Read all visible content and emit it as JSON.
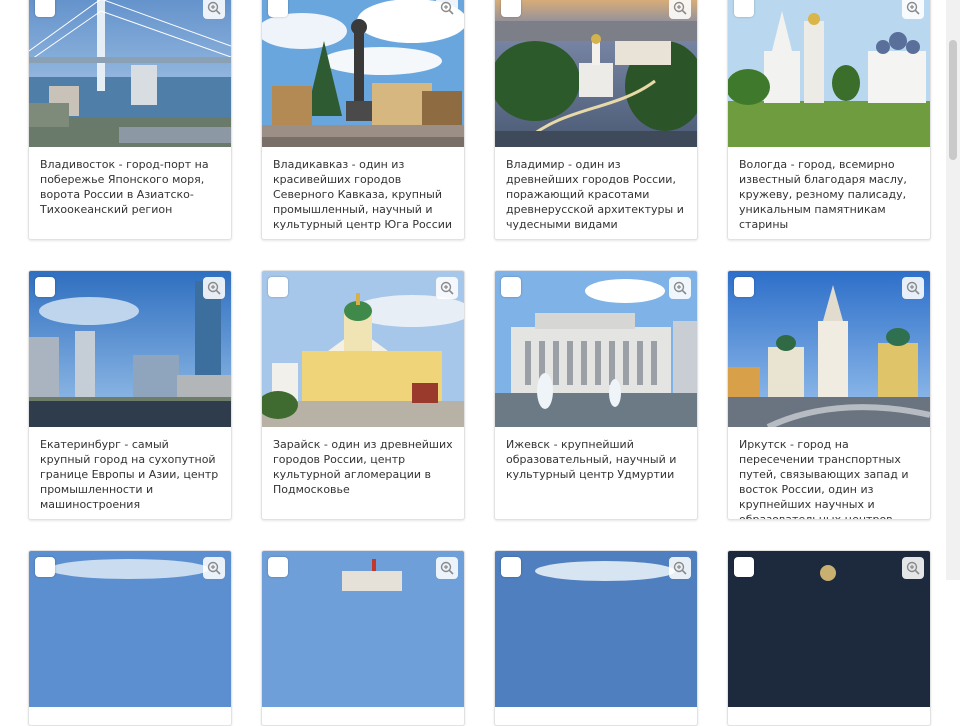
{
  "cards": [
    {
      "caption": "Владивосток - город-порт на побережье Японского моря, ворота России в Азиатско-Тихоокеанский регион"
    },
    {
      "caption": "Владикавказ - один из красивейших городов Северного Кавказа, крупный промышленный, научный и культурный центр Юга России"
    },
    {
      "caption": "Владимир - один из древнейших городов России, поражающий красотами древнерусской архитектуры и чудесными видами"
    },
    {
      "caption": "Вологда - город, всемирно известный благодаря маслу, кружеву, резному палисаду, уникальным памятникам старины"
    },
    {
      "caption": "Екатеринбург - самый крупный город на сухопутной границе Европы и Азии, центр промышленности и машиностроения"
    },
    {
      "caption": "Зарайск - один из древнейших городов России, центр культурной агломерации в Подмосковье"
    },
    {
      "caption": "Ижевск - крупнейший образовательный, научный и культурный центр Удмуртии"
    },
    {
      "caption": "Иркутск - город на пересечении транспортных путей, связывающих запад и восток России, один из крупнейших научных и образовательных центров Сибири"
    },
    {
      "caption": ""
    },
    {
      "caption": ""
    },
    {
      "caption": ""
    },
    {
      "caption": ""
    }
  ]
}
